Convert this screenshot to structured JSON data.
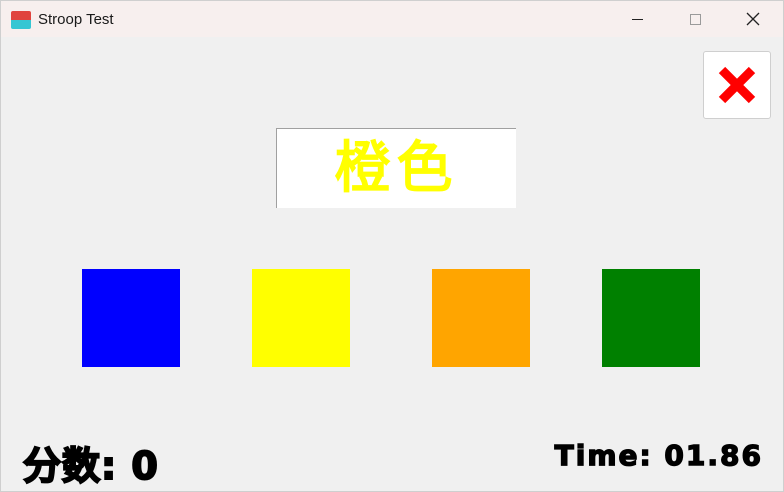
{
  "window": {
    "title": "Stroop Test",
    "controls": {
      "minimize": "minimize",
      "maximize": "maximize",
      "close": "close"
    }
  },
  "game": {
    "word": "橙色",
    "word_color": "#ffff00",
    "options": [
      {
        "name": "blue",
        "color": "#0000ff"
      },
      {
        "name": "yellow",
        "color": "#ffff00"
      },
      {
        "name": "orange",
        "color": "#ffa500"
      },
      {
        "name": "green",
        "color": "#008000"
      }
    ],
    "score_label": "分数: 0",
    "time_label": "Time: 01.86",
    "close_icon_color": "#ff0000"
  },
  "icons": {
    "app": "app-icon",
    "exit": "red-x-icon"
  }
}
